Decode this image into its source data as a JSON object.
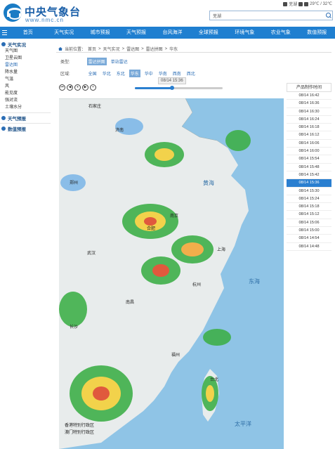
{
  "header": {
    "logo_cn": "中央气象台",
    "logo_url": "www.nmc.cn",
    "city": "芜湖",
    "temp": "29℃ / 32℃",
    "search_value": "芜湖"
  },
  "nav": {
    "items": [
      {
        "label": "首页"
      },
      {
        "label": "天气实况"
      },
      {
        "label": "城市预报"
      },
      {
        "label": "天气预报"
      },
      {
        "label": "台风海洋"
      },
      {
        "label": "全球预报"
      },
      {
        "label": "环境气象"
      },
      {
        "label": "农业气象"
      },
      {
        "label": "数值预报"
      }
    ]
  },
  "sidebar": {
    "section1": "天气实况",
    "items": [
      {
        "label": "天气图"
      },
      {
        "label": "卫星云图"
      },
      {
        "label": "雷达图"
      },
      {
        "label": "降水量"
      },
      {
        "label": "气温"
      },
      {
        "label": "风"
      },
      {
        "label": "能见度"
      },
      {
        "label": "强对流"
      },
      {
        "label": "土壤水分"
      }
    ],
    "section2": "天气预报",
    "section3": "数值预报"
  },
  "breadcrumb": [
    "当前位置：",
    "首页",
    "天气实况",
    "雷达图",
    "雷达拼图",
    "华东"
  ],
  "filters": {
    "type_label": "类型:",
    "types": [
      {
        "label": "雷达拼图",
        "selected": true
      },
      {
        "label": "单站雷达",
        "selected": false
      }
    ],
    "region_label": "区域:",
    "regions": [
      {
        "label": "全国",
        "selected": false
      },
      {
        "label": "华北",
        "selected": false
      },
      {
        "label": "东北",
        "selected": false
      },
      {
        "label": "华东",
        "selected": true
      },
      {
        "label": "华中",
        "selected": false
      },
      {
        "label": "华南",
        "selected": false
      },
      {
        "label": "西南",
        "selected": false
      },
      {
        "label": "西北",
        "selected": false
      }
    ]
  },
  "player": {
    "tooltip": "08/14 15:36",
    "progress": 0.42,
    "controls": [
      "⏮",
      "◀",
      "⏸",
      "▶",
      "+"
    ]
  },
  "map": {
    "labels": [
      {
        "text": "石家庄"
      },
      {
        "text": "济南"
      },
      {
        "text": "郑州"
      },
      {
        "text": "合肥"
      },
      {
        "text": "南京"
      },
      {
        "text": "上海"
      },
      {
        "text": "杭州"
      },
      {
        "text": "武汉"
      },
      {
        "text": "南昌"
      },
      {
        "text": "长沙"
      },
      {
        "text": "福州"
      },
      {
        "text": "台北"
      }
    ],
    "seas": [
      {
        "text": "黄海"
      },
      {
        "text": "东海"
      },
      {
        "text": "太平洋"
      }
    ],
    "legend1": "香港特别行政区",
    "legend2": "澳门特别行政区"
  },
  "times": {
    "header": "产品制作时间",
    "items": [
      {
        "label": "08/14 16:42"
      },
      {
        "label": "08/14 16:36"
      },
      {
        "label": "08/14 16:30"
      },
      {
        "label": "08/14 16:24"
      },
      {
        "label": "08/14 16:18"
      },
      {
        "label": "08/14 16:12"
      },
      {
        "label": "08/14 16:06"
      },
      {
        "label": "08/14 16:00"
      },
      {
        "label": "08/14 15:54"
      },
      {
        "label": "08/14 15:48"
      },
      {
        "label": "08/14 15:42"
      },
      {
        "label": "08/14 15:36",
        "active": true
      },
      {
        "label": "08/14 15:30"
      },
      {
        "label": "08/14 15:24"
      },
      {
        "label": "08/14 15:18"
      },
      {
        "label": "08/14 15:12"
      },
      {
        "label": "08/14 15:06"
      },
      {
        "label": "08/14 15:00"
      },
      {
        "label": "08/14 14:54"
      },
      {
        "label": "08/14 14:48"
      }
    ]
  }
}
